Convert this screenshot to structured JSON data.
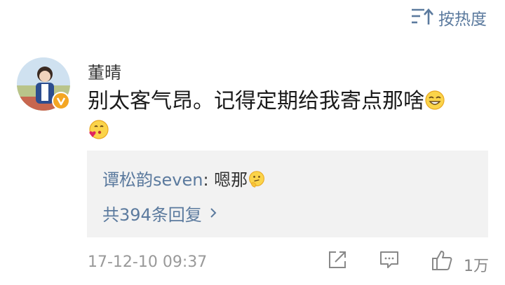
{
  "header": {
    "sort_label": "按热度",
    "sort_icon": "sort-hot-icon"
  },
  "comment": {
    "avatar": "user-avatar-photo",
    "verified_badge": "verified-v-icon",
    "username": "董晴",
    "text": "别太客气昂。记得定期给我寄点那啥",
    "emojis": [
      "grin-emoji",
      "kiss-heart-emoji"
    ]
  },
  "reply_preview": {
    "author": "谭松韵seven",
    "colon": ": ",
    "text": "嗯那",
    "emoji": "thinking-emoji",
    "more_label": "共394条回复"
  },
  "footer": {
    "timestamp": "17-12-10 09:37",
    "like_count": "1万",
    "icons": [
      "share-icon",
      "comment-icon",
      "like-icon"
    ]
  },
  "colors": {
    "link": "#5b7a9e",
    "badge": "#f4a623",
    "reply_bg": "#f2f2f2"
  }
}
